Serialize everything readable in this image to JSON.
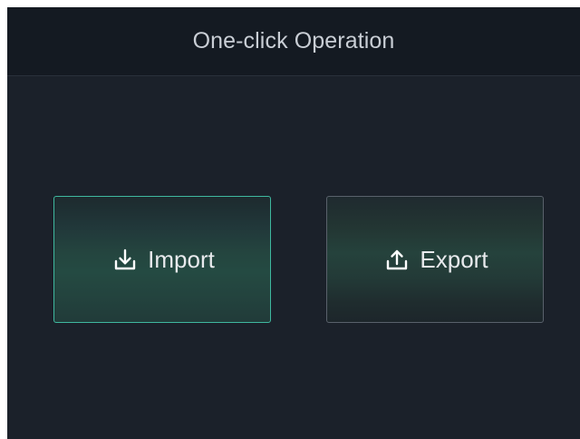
{
  "header": {
    "title": "One-click Operation"
  },
  "actions": {
    "import": {
      "label": "Import",
      "icon": "download-icon",
      "accent": "#3fb89f"
    },
    "export": {
      "label": "Export",
      "icon": "upload-icon",
      "accent": "#59616b"
    }
  },
  "colors": {
    "background": "#1b212a",
    "header_background": "#141a22",
    "text": "#e8eaed"
  }
}
